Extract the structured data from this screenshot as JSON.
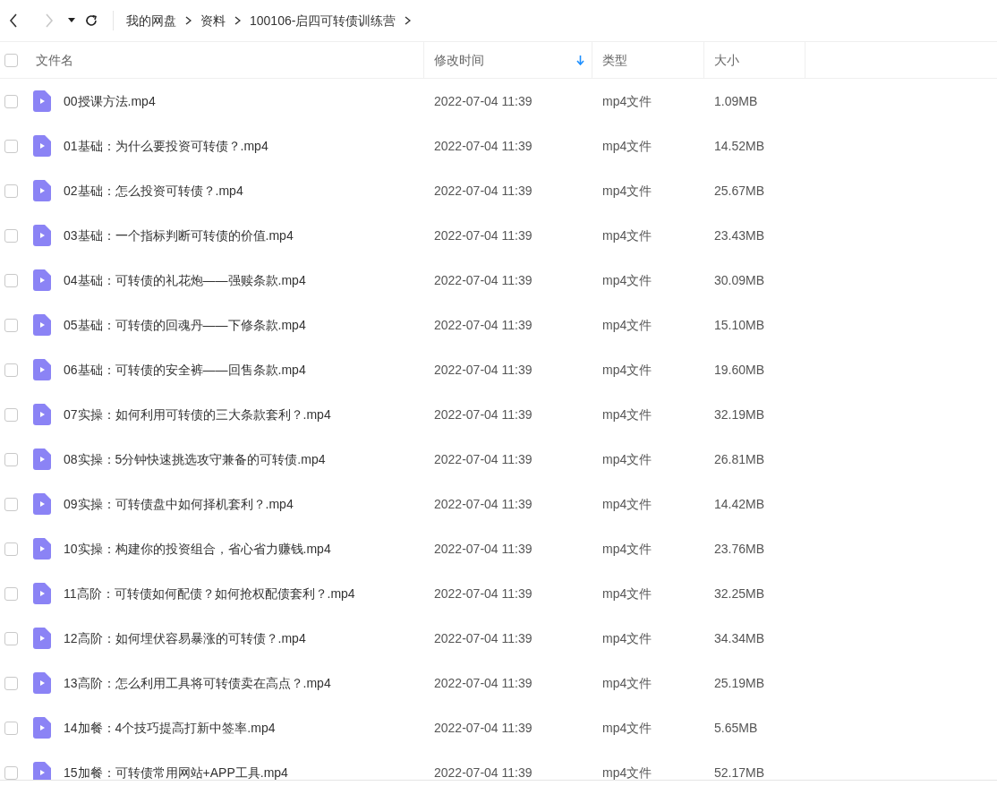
{
  "toolbar": {
    "back": {
      "disabled": false
    },
    "forward": {
      "disabled": true
    }
  },
  "breadcrumb": [
    "我的网盘",
    "资料",
    "100106-启四可转债训练营"
  ],
  "header": {
    "select_all": {
      "checked": false
    },
    "columns": [
      {
        "label": "文件名",
        "sorted": false
      },
      {
        "label": "修改时间",
        "sorted": true
      },
      {
        "label": "类型",
        "sorted": false
      },
      {
        "label": "大小",
        "sorted": false
      }
    ]
  },
  "rows": [
    {
      "name": "00授课方法.mp4",
      "modified": "2022-07-04 11:39",
      "type": "mp4文件",
      "size": "1.09MB",
      "checked": false
    },
    {
      "name": "01基础：为什么要投资可转债？.mp4",
      "modified": "2022-07-04 11:39",
      "type": "mp4文件",
      "size": "14.52MB",
      "checked": false
    },
    {
      "name": "02基础：怎么投资可转债？.mp4",
      "modified": "2022-07-04 11:39",
      "type": "mp4文件",
      "size": "25.67MB",
      "checked": false
    },
    {
      "name": "03基础：一个指标判断可转债的价值.mp4",
      "modified": "2022-07-04 11:39",
      "type": "mp4文件",
      "size": "23.43MB",
      "checked": false
    },
    {
      "name": "04基础：可转债的礼花炮——强赎条款.mp4",
      "modified": "2022-07-04 11:39",
      "type": "mp4文件",
      "size": "30.09MB",
      "checked": false
    },
    {
      "name": "05基础：可转债的回魂丹——下修条款.mp4",
      "modified": "2022-07-04 11:39",
      "type": "mp4文件",
      "size": "15.10MB",
      "checked": false
    },
    {
      "name": "06基础：可转债的安全裤——回售条款.mp4",
      "modified": "2022-07-04 11:39",
      "type": "mp4文件",
      "size": "19.60MB",
      "checked": false
    },
    {
      "name": "07实操：如何利用可转债的三大条款套利？.mp4",
      "modified": "2022-07-04 11:39",
      "type": "mp4文件",
      "size": "32.19MB",
      "checked": false
    },
    {
      "name": "08实操：5分钟快速挑选攻守兼备的可转债.mp4",
      "modified": "2022-07-04 11:39",
      "type": "mp4文件",
      "size": "26.81MB",
      "checked": false
    },
    {
      "name": "09实操：可转债盘中如何择机套利？.mp4",
      "modified": "2022-07-04 11:39",
      "type": "mp4文件",
      "size": "14.42MB",
      "checked": false
    },
    {
      "name": "10实操：构建你的投资组合，省心省力赚钱.mp4",
      "modified": "2022-07-04 11:39",
      "type": "mp4文件",
      "size": "23.76MB",
      "checked": false
    },
    {
      "name": "11高阶：可转债如何配债？如何抢权配债套利？.mp4",
      "modified": "2022-07-04 11:39",
      "type": "mp4文件",
      "size": "32.25MB",
      "checked": false
    },
    {
      "name": "12高阶：如何埋伏容易暴涨的可转债？.mp4",
      "modified": "2022-07-04 11:39",
      "type": "mp4文件",
      "size": "34.34MB",
      "checked": false
    },
    {
      "name": "13高阶：怎么利用工具将可转债卖在高点？.mp4",
      "modified": "2022-07-04 11:39",
      "type": "mp4文件",
      "size": "25.19MB",
      "checked": false
    },
    {
      "name": "14加餐：4个技巧提高打新中签率.mp4",
      "modified": "2022-07-04 11:39",
      "type": "mp4文件",
      "size": "5.65MB",
      "checked": false
    },
    {
      "name": "15加餐：可转债常用网站+APP工具.mp4",
      "modified": "2022-07-04 11:39",
      "type": "mp4文件",
      "size": "52.17MB",
      "checked": false
    }
  ]
}
